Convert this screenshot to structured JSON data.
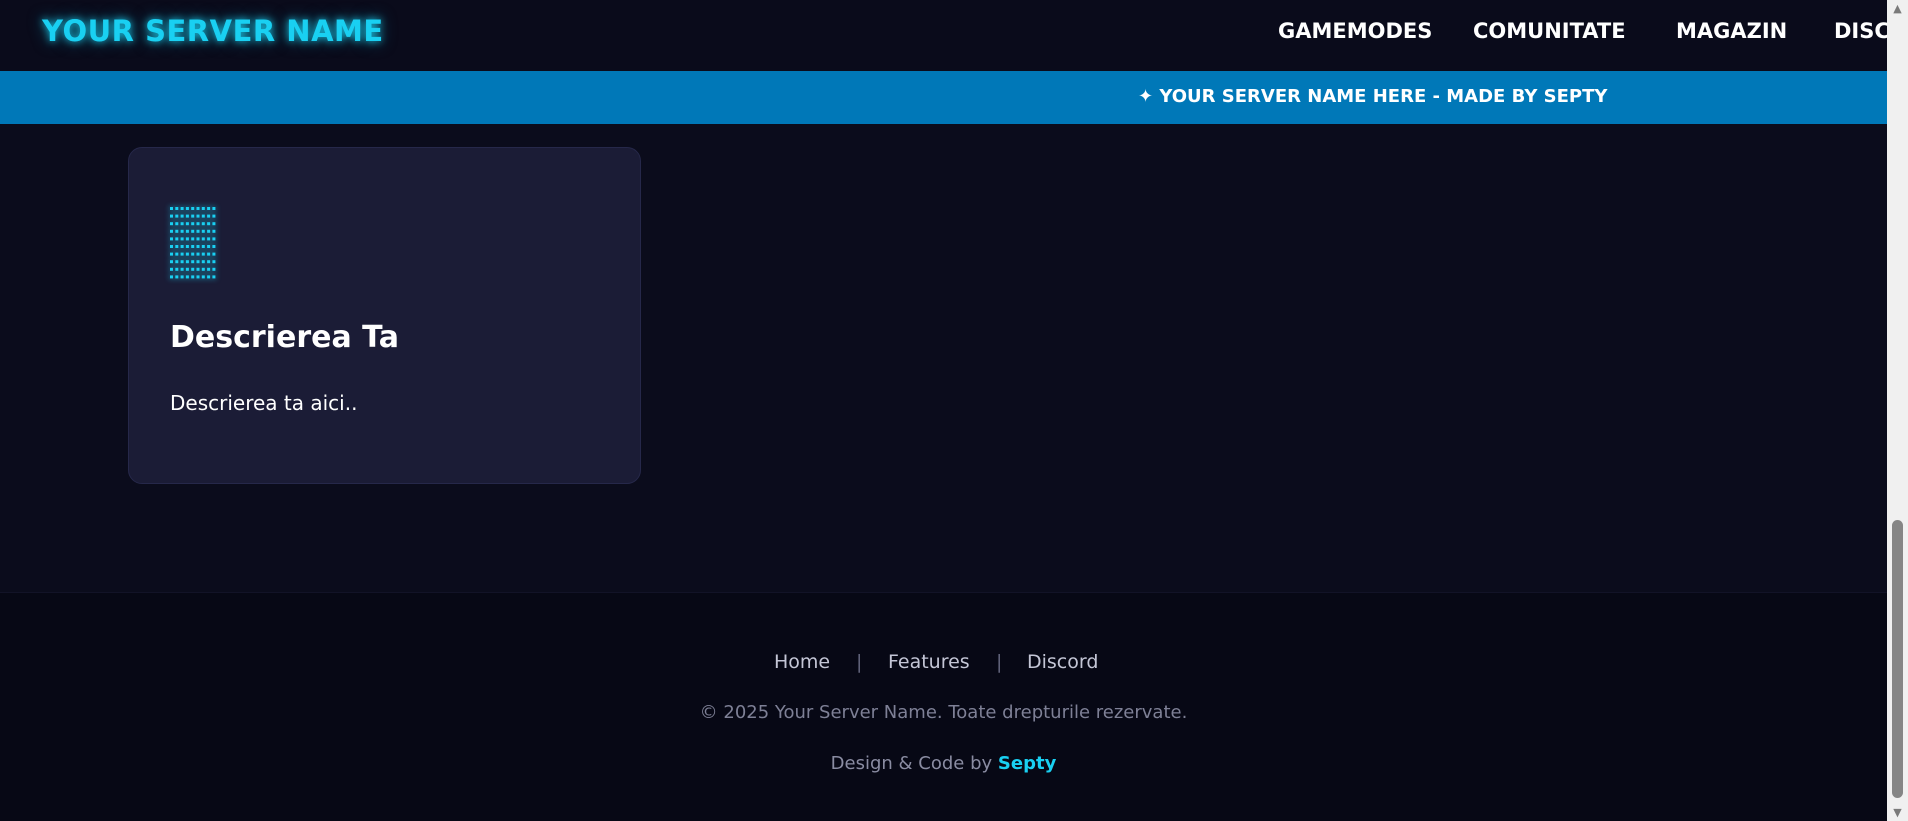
{
  "header": {
    "logo": "YOUR SERVER NAME",
    "nav": [
      "GAMEMODES",
      "COMUNITATE",
      "MAGAZIN",
      "DISCORD"
    ]
  },
  "banner": {
    "text": "✦ YOUR SERVER NAME HERE - MADE BY SEPTY"
  },
  "card": {
    "icon": "server-dots-icon",
    "title": "Descrierea Ta",
    "description": "Descrierea ta aici.."
  },
  "footer": {
    "links": [
      "Home",
      "Features",
      "Discord"
    ],
    "separator": "|",
    "copyright": "© 2025 Your Server Name. Toate drepturile rezervate.",
    "credits_prefix": "Design & Code by ",
    "credits_author": "Septy"
  },
  "colors": {
    "accent": "#19d0f2",
    "banner": "#0078b8",
    "background": "#0b0c1c",
    "card": "#1b1c36",
    "footer": "#070815"
  }
}
